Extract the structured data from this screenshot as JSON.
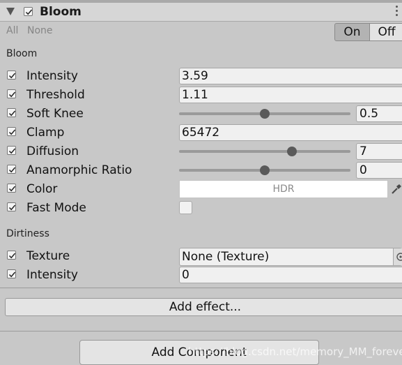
{
  "effect": {
    "title": "Bloom",
    "enabled": true
  },
  "links": {
    "all": "All",
    "none": "None"
  },
  "toggle": {
    "on": "On",
    "off": "Off",
    "selected": "On"
  },
  "bloom_section": {
    "title": "Bloom",
    "intensity": {
      "label": "Intensity",
      "value": "3.59"
    },
    "threshold": {
      "label": "Threshold",
      "value": "1.11"
    },
    "soft_knee": {
      "label": "Soft Knee",
      "value": "0.5",
      "slider_fraction": 0.5
    },
    "clamp": {
      "label": "Clamp",
      "value": "65472"
    },
    "diffusion": {
      "label": "Diffusion",
      "value": "7",
      "slider_fraction": 0.66
    },
    "anamorphic_ratio": {
      "label": "Anamorphic Ratio",
      "value": "0",
      "slider_fraction": 0.5
    },
    "color": {
      "label": "Color",
      "value": "HDR",
      "swatch": "#ffffff"
    },
    "fast_mode": {
      "label": "Fast Mode",
      "checked": false
    }
  },
  "dirtiness_section": {
    "title": "Dirtiness",
    "texture": {
      "label": "Texture",
      "value": "None (Texture)"
    },
    "intensity": {
      "label": "Intensity",
      "value": "0"
    }
  },
  "buttons": {
    "add_effect": "Add effect...",
    "add_component": "Add Component"
  },
  "watermark": "https://blog.csdn.net/memory_MM_forever"
}
